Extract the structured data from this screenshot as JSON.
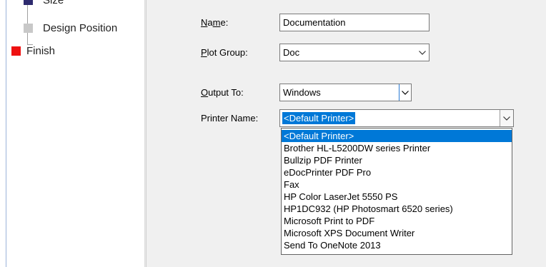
{
  "wizard_tree": {
    "items": [
      {
        "label": "Size",
        "state": "completed"
      },
      {
        "label": "Design Position",
        "state": "pending"
      },
      {
        "label": "Finish",
        "state": "current"
      }
    ]
  },
  "form": {
    "name_label": "Name:",
    "name_value": "Documentation",
    "plot_group_label": "Plot Group:",
    "plot_group_value": "Doc",
    "output_to_label": "Output To:",
    "output_to_value": "Windows",
    "printer_name_label": "Printer Name:",
    "printer_name_value": "<Default Printer>"
  },
  "printer_dropdown": {
    "options": [
      "<Default Printer>",
      "Brother HL-L5200DW series Printer",
      "Bullzip PDF Printer",
      "eDocPrinter PDF Pro",
      "Fax",
      "HP Color LaserJet 5550 PS",
      "HP1DC932 (HP Photosmart 6520 series)",
      "Microsoft Print to PDF",
      "Microsoft XPS Document Writer",
      "Send To OneNote 2013"
    ],
    "selected_index": 0
  },
  "colors": {
    "selection": "#0078d7",
    "finish_marker": "#ee1111",
    "completed_marker": "#2d2a6e",
    "pending_marker": "#c8c8c8"
  }
}
